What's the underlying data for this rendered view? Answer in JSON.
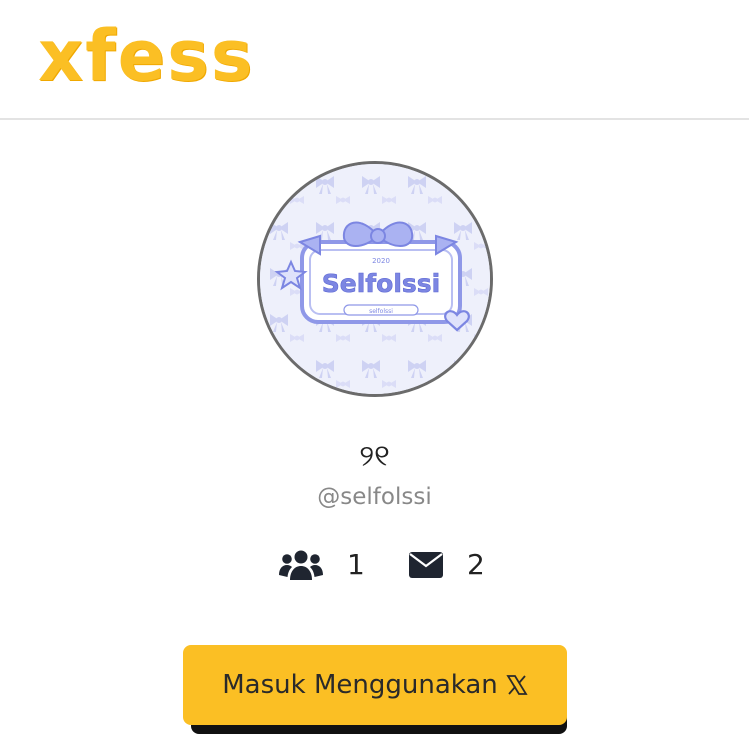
{
  "app": {
    "logo_text": "xfess",
    "brand_color": "#FBBF24"
  },
  "profile": {
    "avatar": {
      "year": "2020",
      "title": "Selfolssi",
      "tag": "selfolssi"
    },
    "display_name": "୨୧",
    "handle": "@selfolssi",
    "stats": {
      "followers_icon": "users-icon",
      "followers": "1",
      "messages_icon": "envelope-icon",
      "messages": "2"
    }
  },
  "login": {
    "label": "Masuk Menggunakan",
    "icon": "x-logo-icon"
  }
}
